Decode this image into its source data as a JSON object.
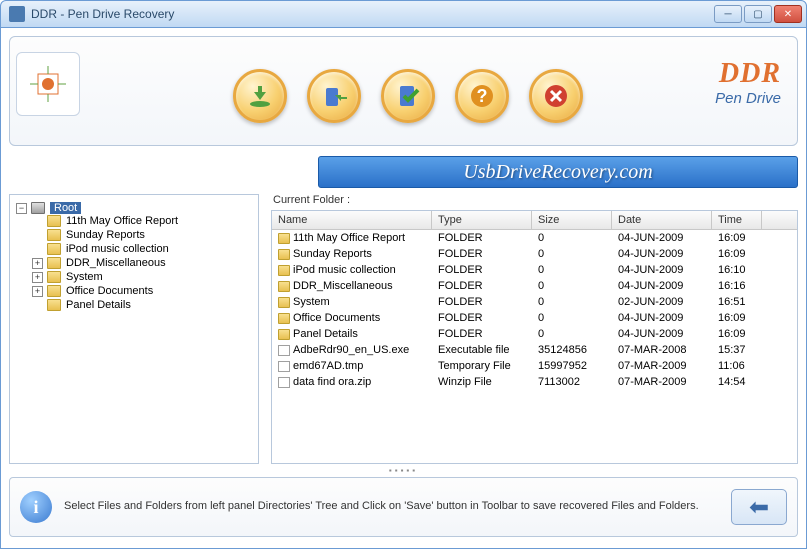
{
  "window": {
    "title": "DDR - Pen Drive Recovery"
  },
  "brand": {
    "name": "DDR",
    "sub": "Pen Drive"
  },
  "url_banner": "UsbDriveRecovery.com",
  "tree": {
    "root_label": "Root",
    "nodes": [
      {
        "label": "11th May Office Report",
        "expandable": false
      },
      {
        "label": "Sunday Reports",
        "expandable": false
      },
      {
        "label": "iPod music collection",
        "expandable": false
      },
      {
        "label": "DDR_Miscellaneous",
        "expandable": true
      },
      {
        "label": "System",
        "expandable": true
      },
      {
        "label": "Office Documents",
        "expandable": true
      },
      {
        "label": "Panel Details",
        "expandable": false
      }
    ]
  },
  "list": {
    "current_folder_label": "Current Folder  :",
    "columns": {
      "name": "Name",
      "type": "Type",
      "size": "Size",
      "date": "Date",
      "time": "Time"
    },
    "rows": [
      {
        "icon": "folder",
        "name": "11th May Office Report",
        "type": "FOLDER",
        "size": "0",
        "date": "04-JUN-2009",
        "time": "16:09"
      },
      {
        "icon": "folder",
        "name": "Sunday Reports",
        "type": "FOLDER",
        "size": "0",
        "date": "04-JUN-2009",
        "time": "16:09"
      },
      {
        "icon": "folder",
        "name": "iPod music collection",
        "type": "FOLDER",
        "size": "0",
        "date": "04-JUN-2009",
        "time": "16:10"
      },
      {
        "icon": "folder",
        "name": "DDR_Miscellaneous",
        "type": "FOLDER",
        "size": "0",
        "date": "04-JUN-2009",
        "time": "16:16"
      },
      {
        "icon": "folder",
        "name": "System",
        "type": "FOLDER",
        "size": "0",
        "date": "02-JUN-2009",
        "time": "16:51"
      },
      {
        "icon": "folder",
        "name": "Office Documents",
        "type": "FOLDER",
        "size": "0",
        "date": "04-JUN-2009",
        "time": "16:09"
      },
      {
        "icon": "folder",
        "name": "Panel Details",
        "type": "FOLDER",
        "size": "0",
        "date": "04-JUN-2009",
        "time": "16:09"
      },
      {
        "icon": "file",
        "name": "AdbeRdr90_en_US.exe",
        "type": "Executable file",
        "size": "35124856",
        "date": "07-MAR-2008",
        "time": "15:37"
      },
      {
        "icon": "file",
        "name": "emd67AD.tmp",
        "type": "Temporary File",
        "size": "15997952",
        "date": "07-MAR-2009",
        "time": "11:06"
      },
      {
        "icon": "file",
        "name": "data find ora.zip",
        "type": "Winzip File",
        "size": "7113002",
        "date": "07-MAR-2009",
        "time": "14:54"
      }
    ]
  },
  "hint": "Select Files and Folders from left panel Directories' Tree and Click on 'Save' button in Toolbar to save recovered Files and Folders."
}
